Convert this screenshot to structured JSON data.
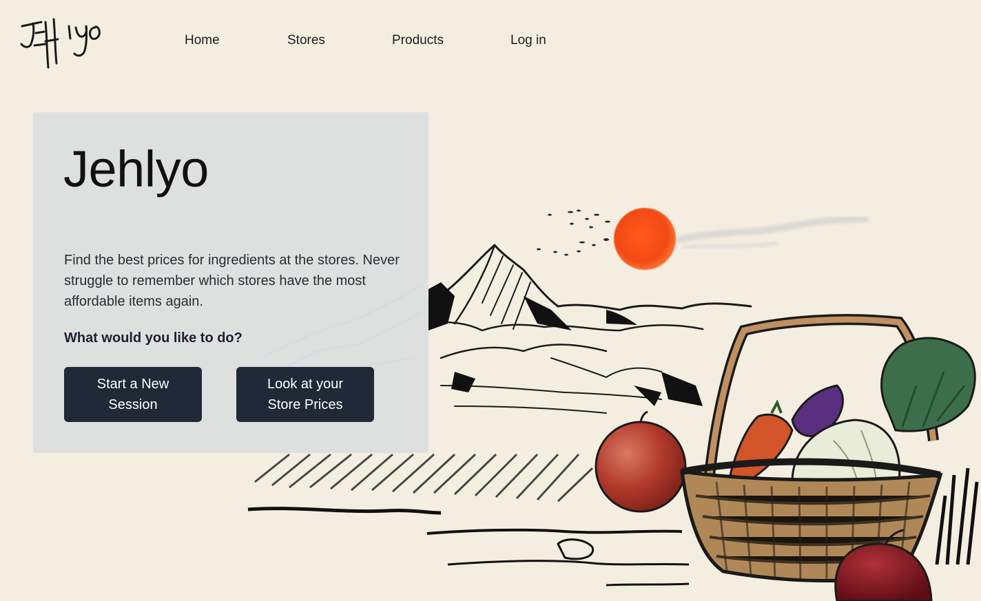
{
  "nav": {
    "items": [
      {
        "label": "Home"
      },
      {
        "label": "Stores"
      },
      {
        "label": "Products"
      },
      {
        "label": "Log in"
      }
    ]
  },
  "hero": {
    "title": "Jehlyo",
    "description": "Find the best prices for ingredients at the stores. Never struggle to remember which stores have the most affordable items again.",
    "prompt": "What would you like to do?",
    "buttons": {
      "start_session": "Start a New Session",
      "store_prices": "Look at your Store Prices"
    }
  },
  "colors": {
    "background": "#f4eee0",
    "card": "#dbdee0",
    "button": "#1f2937",
    "sun": "#f0501a"
  }
}
